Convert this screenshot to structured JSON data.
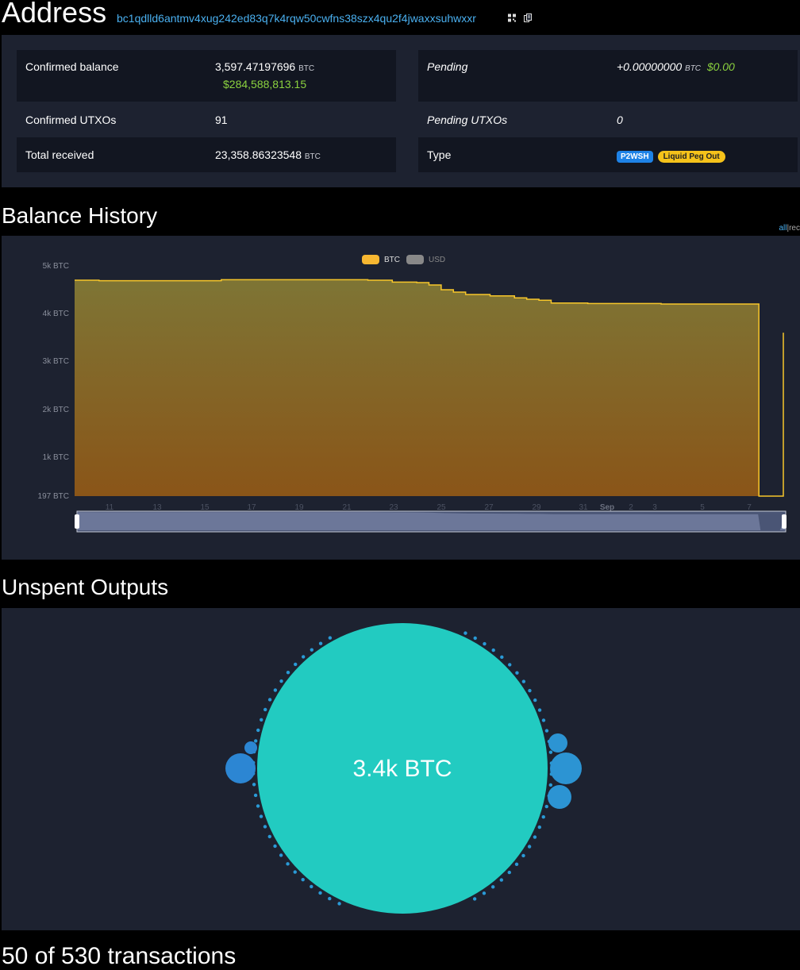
{
  "header": {
    "title": "Address",
    "address": "bc1qdlld6antmv4xug242ed83q7k4rqw50cwfns38szx4qu2f4jwaxxsuhwxxr",
    "qr_icon": "qr-code-icon",
    "copy_icon": "copy-icon"
  },
  "summary": {
    "confirmed_balance_label": "Confirmed balance",
    "confirmed_balance_value": "3,597.47197696",
    "confirmed_balance_unit": "BTC",
    "confirmed_balance_usd": "$284,588,813.15",
    "confirmed_utxos_label": "Confirmed UTXOs",
    "confirmed_utxos_value": "91",
    "total_received_label": "Total received",
    "total_received_value": "23,358.86323548",
    "total_received_unit": "BTC",
    "pending_label": "Pending",
    "pending_value": "+0.00000000",
    "pending_unit": "BTC",
    "pending_usd": "$0.00",
    "pending_utxos_label": "Pending UTXOs",
    "pending_utxos_value": "0",
    "type_label": "Type",
    "type_badge_1": "P2WSH",
    "type_badge_2": "Liquid Peg Out"
  },
  "balance_history": {
    "title": "Balance History",
    "range_all": "all",
    "range_recent": "rec",
    "separator": "|"
  },
  "chart_data": {
    "type": "area",
    "legend": [
      {
        "name": "BTC",
        "color": "#f7b731"
      },
      {
        "name": "USD",
        "color": "#888888"
      }
    ],
    "y_ticks": [
      "197 BTC",
      "1k BTC",
      "2k BTC",
      "3k BTC",
      "4k BTC",
      "5k BTC"
    ],
    "x_ticks": [
      "11",
      "13",
      "15",
      "17",
      "19",
      "21",
      "23",
      "25",
      "27",
      "29",
      "31",
      "Sep",
      "2",
      "3",
      "5",
      "7"
    ],
    "ylim": [
      197,
      5000
    ],
    "series": [
      {
        "name": "BTC",
        "x": [
          9,
          10,
          15,
          21,
          22,
          23,
          23.5,
          24,
          24.5,
          25,
          26,
          27,
          27.5,
          28,
          28.5,
          29,
          30,
          31,
          32,
          33,
          34,
          35,
          36,
          36.9,
          37,
          37.8,
          38
        ],
        "values": [
          4700,
          4690,
          4710,
          4700,
          4660,
          4650,
          4600,
          4500,
          4450,
          4400,
          4370,
          4330,
          4300,
          4280,
          4220,
          4220,
          4210,
          4210,
          4210,
          4200,
          4200,
          4200,
          4200,
          4200,
          197,
          197,
          3597
        ]
      }
    ]
  },
  "unspent": {
    "title": "Unspent Outputs",
    "big_label": "3.4k BTC"
  },
  "transactions": {
    "title": "50 of 530 transactions"
  }
}
